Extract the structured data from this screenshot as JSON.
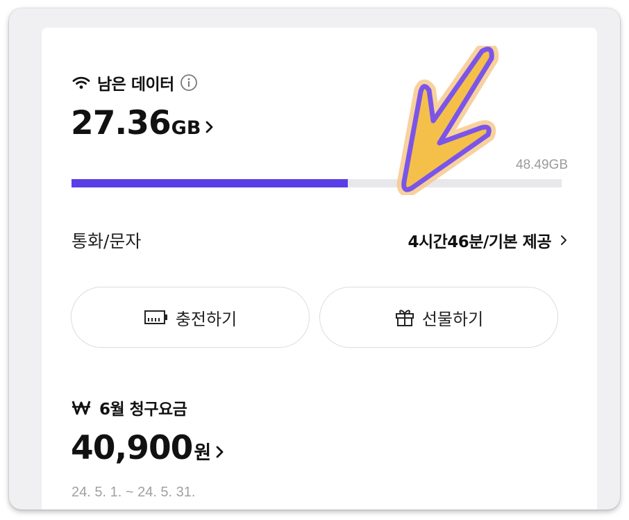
{
  "data_section": {
    "title": "남은 데이터",
    "remaining_value": "27.36",
    "remaining_unit": "GB",
    "total": "48.49GB",
    "usage_fraction": 0.564
  },
  "call_section": {
    "label": "통화/문자",
    "value": "4시간46분/기본 제공"
  },
  "buttons": {
    "charge": "충전하기",
    "gift": "선물하기"
  },
  "bill_section": {
    "title": "6월 청구요금",
    "amount": "40,900",
    "unit": "원",
    "period": "24. 5. 1. ~ 24. 5. 31."
  },
  "icons": {
    "wifi": "wifi-icon",
    "info": "info-icon",
    "chevron": "chevron-right-icon",
    "battery": "battery-charge-icon",
    "gift": "gift-icon",
    "won": "won-currency-icon",
    "annotation": "arrow-annotation-icon"
  },
  "colors": {
    "accent": "#5a3fe6",
    "annotation_fill": "#f4c04a",
    "annotation_stroke": "#7b55e8"
  }
}
